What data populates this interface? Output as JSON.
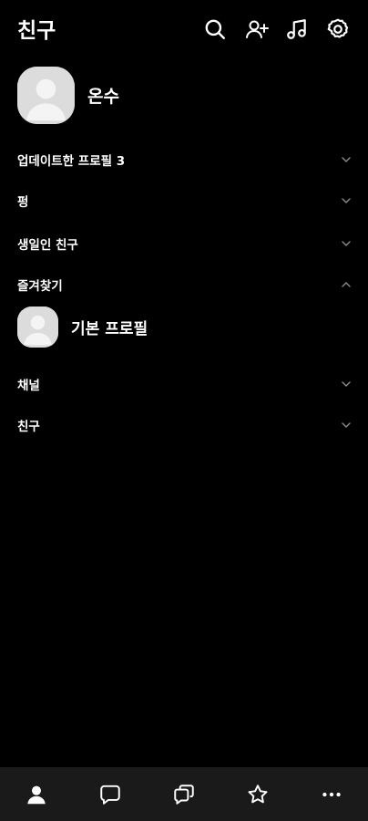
{
  "header": {
    "title": "친구",
    "icons": [
      "search-icon",
      "add-friend-icon",
      "music-icon",
      "settings-icon"
    ]
  },
  "my_profile": {
    "name": "온수"
  },
  "sections": [
    {
      "label": "업데이트한 프로필 3",
      "state": "collapsed"
    },
    {
      "label": "펑",
      "state": "collapsed"
    },
    {
      "label": "생일인 친구",
      "state": "collapsed"
    },
    {
      "label": "즐겨찾기",
      "state": "expanded"
    },
    {
      "label": "채널",
      "state": "collapsed"
    },
    {
      "label": "친구",
      "state": "collapsed"
    }
  ],
  "favorites": [
    {
      "name": "기본 프로필"
    }
  ],
  "bottom_nav": {
    "items": [
      "friends-icon",
      "chat-icon",
      "open-chat-icon",
      "star-icon",
      "more-icon"
    ],
    "active": "friends-icon"
  },
  "colors": {
    "background": "#000000",
    "text": "#ffffff",
    "chevron": "#8a8a8a",
    "avatar_bg": "#dcdcdc",
    "nav_bg": "#1a1a1a"
  }
}
